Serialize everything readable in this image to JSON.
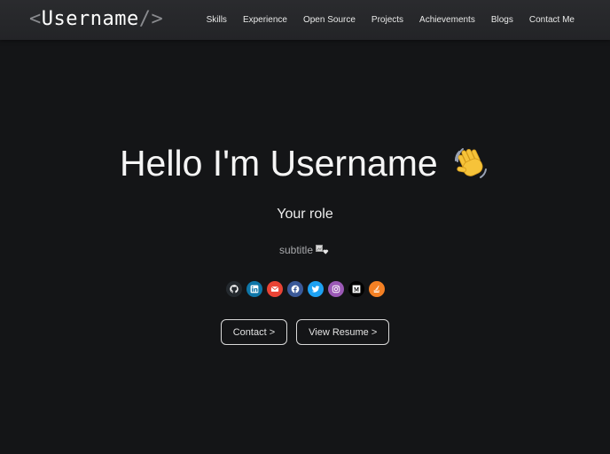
{
  "header": {
    "logo": {
      "open": "<",
      "name": "Username",
      "close": "/>"
    },
    "nav": [
      "Skills",
      "Experience",
      "Open Source",
      "Projects",
      "Achievements",
      "Blogs",
      "Contact Me"
    ]
  },
  "hero": {
    "title": "Hello I'm Username",
    "wave_icon": "waving-hand-emoji",
    "role": "Your role",
    "subtitle": "subtitle",
    "subtitle_icon": "broken-image-icon"
  },
  "socials": [
    {
      "name": "github-icon",
      "color": "#24292e"
    },
    {
      "name": "linkedin-icon",
      "color": "#0e76a8"
    },
    {
      "name": "gmail-icon",
      "color": "#ea4335"
    },
    {
      "name": "facebook-icon",
      "color": "#3b5998"
    },
    {
      "name": "twitter-icon",
      "color": "#1da1f2"
    },
    {
      "name": "instagram-icon",
      "color": "#9b59b6"
    },
    {
      "name": "medium-icon",
      "color": "#000000"
    },
    {
      "name": "stack-overflow-icon",
      "color": "#f48024"
    }
  ],
  "buttons": {
    "contact": "Contact >",
    "resume": "View Resume >"
  },
  "colors": {
    "background": "#141517",
    "header": "#27282b",
    "text": "#ffffff",
    "muted": "#a7a8ab",
    "button_border": "#d9d9d9"
  }
}
